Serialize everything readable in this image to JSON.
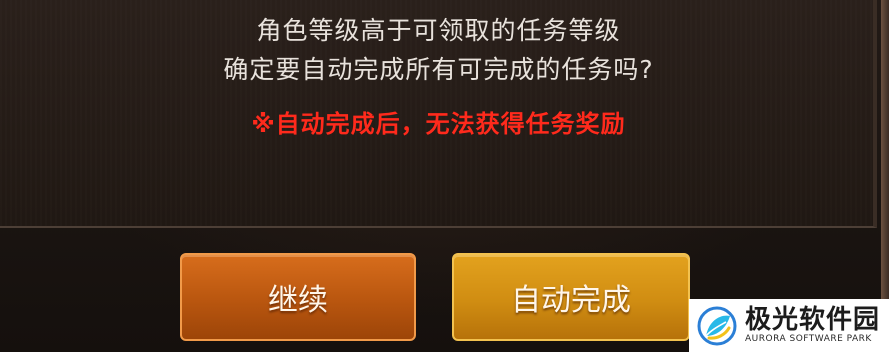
{
  "dialog": {
    "message_line1": "角色等级高于可领取的任务等级",
    "message_line2": "确定要自动完成所有可完成的任务吗?",
    "warning": "※自动完成后，无法获得任务奖励"
  },
  "buttons": {
    "continue_label": "继续",
    "auto_complete_label": "自动完成"
  },
  "watermark": {
    "title": "极光软件园",
    "subtitle": "AURORA SOFTWARE PARK",
    "logo_icon": "aurora-leaf-logo"
  },
  "colors": {
    "warning_text": "#ff2a1c",
    "continue_button": "#c25e12",
    "auto_button": "#d8961a"
  }
}
